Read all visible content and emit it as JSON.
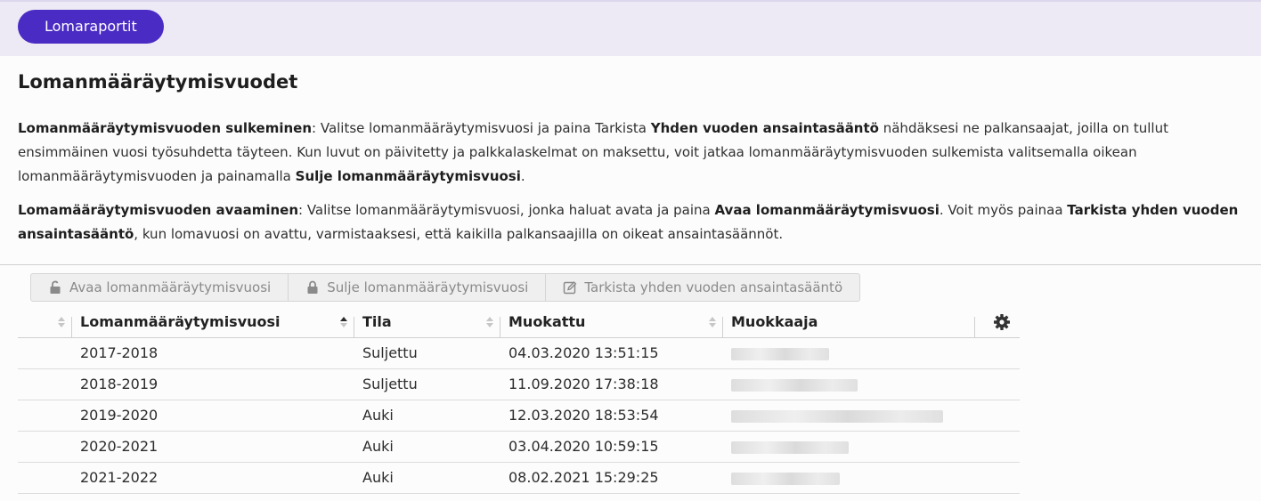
{
  "header": {
    "reports_button": "Lomaraportit"
  },
  "page": {
    "title": "Lomanmääräytymisvuodet",
    "para1": [
      {
        "b": true,
        "t": "Lomanmääräytymisvuoden sulkeminen"
      },
      {
        "b": false,
        "t": ": Valitse lomanmääräytymisvuosi ja paina Tarkista "
      },
      {
        "b": true,
        "t": "Yhden vuoden ansaintasääntö"
      },
      {
        "b": false,
        "t": " nähdäksesi ne palkansaajat, joilla on tullut ensimmäinen vuosi työsuhdetta täyteen. Kun luvut on päivitetty ja palkkalaskelmat on maksettu, voit jatkaa lomanmääräytymisvuoden sulkemista valitsemalla oikean lomanmääräytymisvuoden ja painamalla "
      },
      {
        "b": true,
        "t": "Sulje lomanmääräytymisvuosi"
      },
      {
        "b": false,
        "t": "."
      }
    ],
    "para2": [
      {
        "b": true,
        "t": "Lomamääräytymisvuoden avaaminen"
      },
      {
        "b": false,
        "t": ": Valitse lomanmääräytymisvuosi, jonka haluat avata ja paina "
      },
      {
        "b": true,
        "t": "Avaa lomanmääräytymisvuosi"
      },
      {
        "b": false,
        "t": ". Voit myös painaa "
      },
      {
        "b": true,
        "t": "Tarkista yhden vuoden ansaintasääntö"
      },
      {
        "b": false,
        "t": ", kun lomavuosi on avattu, varmistaaksesi, että kaikilla palkansaajilla on oikeat ansaintasäännöt."
      }
    ]
  },
  "toolbar": {
    "open": {
      "label": "Avaa lomanmääräytymisvuosi",
      "icon": "unlock-icon"
    },
    "close": {
      "label": "Sulje lomanmääräytymisvuosi",
      "icon": "lock-icon"
    },
    "check": {
      "label": "Tarkista yhden vuoden ansaintasääntö",
      "icon": "edit-icon"
    }
  },
  "table": {
    "columns": [
      "Lomanmääräytymisvuosi",
      "Tila",
      "Muokattu",
      "Muokkaaja"
    ],
    "sorted_column": "Lomanmääräytymisvuosi",
    "rows": [
      {
        "year": "2017-2018",
        "status": "Suljettu",
        "modified": "04.03.2020 13:51:15"
      },
      {
        "year": "2018-2019",
        "status": "Suljettu",
        "modified": "11.09.2020 17:38:18"
      },
      {
        "year": "2019-2020",
        "status": "Auki",
        "modified": "12.03.2020 18:53:54"
      },
      {
        "year": "2020-2021",
        "status": "Auki",
        "modified": "03.04.2020 10:59:15"
      },
      {
        "year": "2021-2022",
        "status": "Auki",
        "modified": "08.02.2021 15:29:25"
      }
    ]
  },
  "colors": {
    "accent": "#4a2bc4",
    "topbar": "#ede9f5"
  }
}
